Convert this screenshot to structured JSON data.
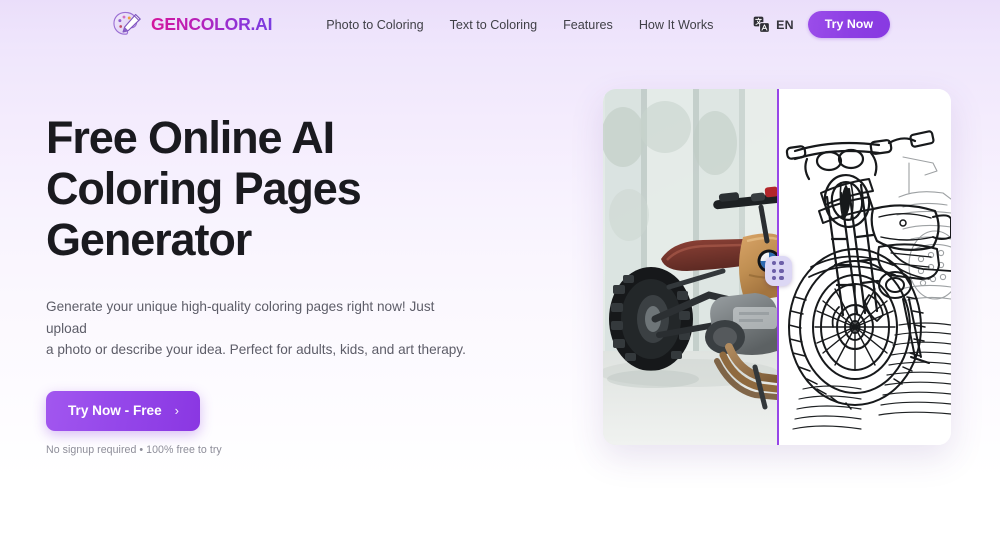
{
  "header": {
    "brand": {
      "name": "GENCOLOR.AI",
      "logo_icon": "palette-brush-icon"
    },
    "nav": [
      {
        "label": "Photo to Coloring",
        "name": "nav-photo-to-coloring"
      },
      {
        "label": "Text to Coloring",
        "name": "nav-text-to-coloring"
      },
      {
        "label": "Features",
        "name": "nav-features"
      },
      {
        "label": "How It Works",
        "name": "nav-how-it-works"
      }
    ],
    "language": {
      "icon": "translate-icon",
      "label": "EN"
    },
    "try_now_label": "Try Now"
  },
  "hero": {
    "headline": "Free Online AI\nColoring Pages\nGenerator",
    "subhead": "Generate your unique high-quality coloring pages right now! Just upload\na photo or describe your idea. Perfect for adults, kids, and art therapy.",
    "cta_label": "Try Now - Free",
    "cta_chevron": "›",
    "cta_note": "No signup required • 100% free to try"
  },
  "compare": {
    "before_alt": "Photograph of a BMW scrambler motorcycle parked indoors by a window",
    "after_alt": "Black and white line-art coloring page of the same motorcycle",
    "divider_position_percent": 50,
    "handle_icon": "drag-handle-dots-icon"
  },
  "colors": {
    "brand_gradient_start": "#d4179c",
    "brand_gradient_end": "#7a3ce0",
    "accent_purple": "#8b3de0",
    "cta_gradient_start": "#a257ef",
    "cta_gradient_end": "#8a37e2",
    "divider_purple": "#9747e8",
    "handle_fill": "#dcd7f4",
    "page_bg_top": "#e9ddfb",
    "page_bg_bottom": "#ffffff",
    "headline_color": "#1a1a1f",
    "subhead_color": "#5d5d68",
    "note_color": "#8d8d99"
  }
}
